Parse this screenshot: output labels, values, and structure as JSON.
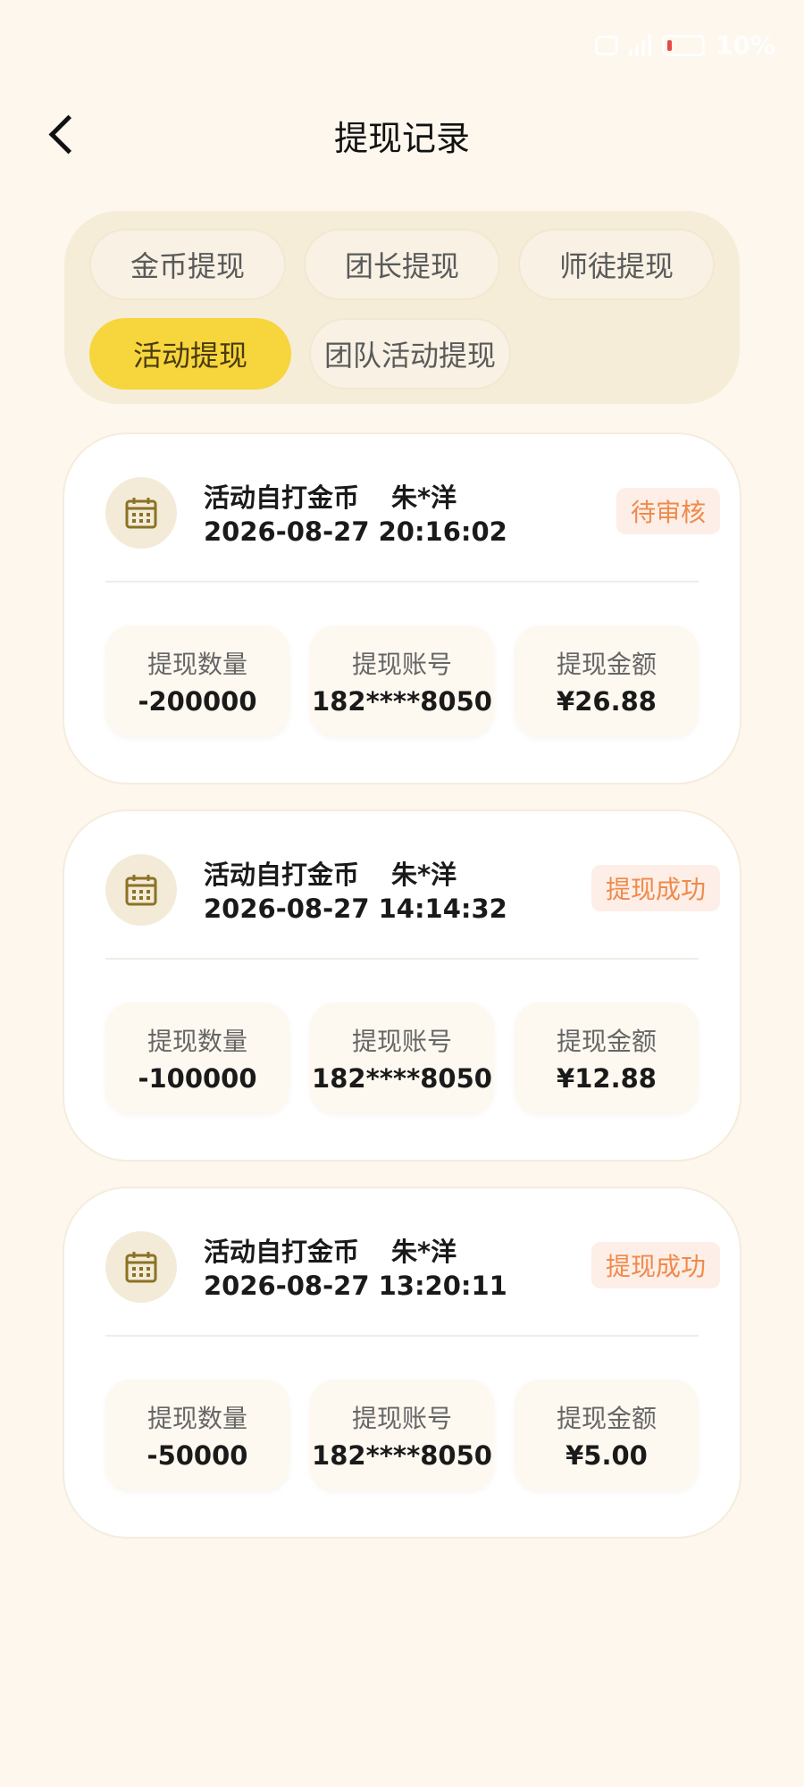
{
  "status_bar": {
    "battery": "10%"
  },
  "header": {
    "title": "提现记录",
    "back_icon": "chevron-left-icon"
  },
  "tabs": [
    {
      "label": "金币提现",
      "active": false
    },
    {
      "label": "团长提现",
      "active": false
    },
    {
      "label": "师徒提现",
      "active": false
    },
    {
      "label": "活动提现",
      "active": true
    },
    {
      "label": "团队活动提现",
      "active": false
    }
  ],
  "colors": {
    "accent": "#f7d53d",
    "status_text": "#f08a4b",
    "background": "#fdf7ee"
  },
  "records": [
    {
      "icon": "calendar-icon",
      "title": "活动自打金币",
      "name": "朱*洋",
      "time": "2026-08-27 20:16:02",
      "status": "待审核",
      "stats": [
        {
          "label": "提现数量",
          "value": "-200000"
        },
        {
          "label": "提现账号",
          "value": "182****8050"
        },
        {
          "label": "提现金额",
          "value": "¥26.88"
        }
      ]
    },
    {
      "icon": "calendar-icon",
      "title": "活动自打金币",
      "name": "朱*洋",
      "time": "2026-08-27 14:14:32",
      "status": "提现成功",
      "stats": [
        {
          "label": "提现数量",
          "value": "-100000"
        },
        {
          "label": "提现账号",
          "value": "182****8050"
        },
        {
          "label": "提现金额",
          "value": "¥12.88"
        }
      ]
    },
    {
      "icon": "calendar-icon",
      "title": "活动自打金币",
      "name": "朱*洋",
      "time": "2026-08-27 13:20:11",
      "status": "提现成功",
      "stats": [
        {
          "label": "提现数量",
          "value": "-50000"
        },
        {
          "label": "提现账号",
          "value": "182****8050"
        },
        {
          "label": "提现金额",
          "value": "¥5.00"
        }
      ]
    }
  ]
}
